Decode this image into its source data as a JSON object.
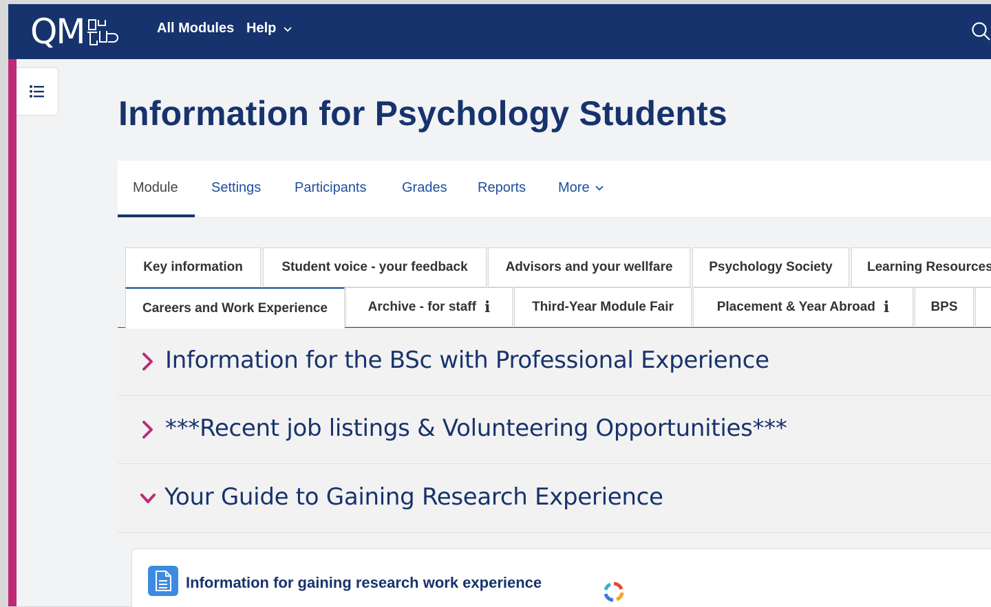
{
  "navbar": {
    "logo_text": "QM",
    "links": {
      "all_modules": "All Modules",
      "help": "Help"
    },
    "help_chevron": "›",
    "icons": {
      "search": "search-icon"
    },
    "background": "#17336d"
  },
  "page": {
    "title": "Information for Psychology Students"
  },
  "secondary_nav": {
    "items": [
      "Module",
      "Settings",
      "Participants",
      "Grades",
      "Reports",
      "More"
    ],
    "active": "Module"
  },
  "tabs": {
    "row1": [
      "Key information",
      "Student voice - your feedback",
      "Advisors and your wellfare",
      "Psychology Society",
      "Learning Resources"
    ],
    "row2": [
      "Careers and Work Experience",
      "Archive - for staff",
      "Third-Year Module Fair",
      "Placement & Year Abroad",
      "BPS"
    ],
    "info_glyph": "i",
    "active": "Careers and Work Experience"
  },
  "sections": [
    {
      "title": "Information for the BSc with Professional Experience",
      "state": "collapsed"
    },
    {
      "title": "***Recent job listings & Volunteering Opportunities***",
      "state": "collapsed"
    },
    {
      "title": "Your Guide to Gaining Research Experience",
      "state": "expanded"
    }
  ],
  "activities": [
    {
      "title": "Information for gaining research work experience",
      "icon": "page-icon"
    }
  ],
  "colors": {
    "brand_navy": "#17336d",
    "accent_pink": "#be2a78",
    "link_blue": "#1d4e9e",
    "page_bg": "#f2f3f5"
  }
}
